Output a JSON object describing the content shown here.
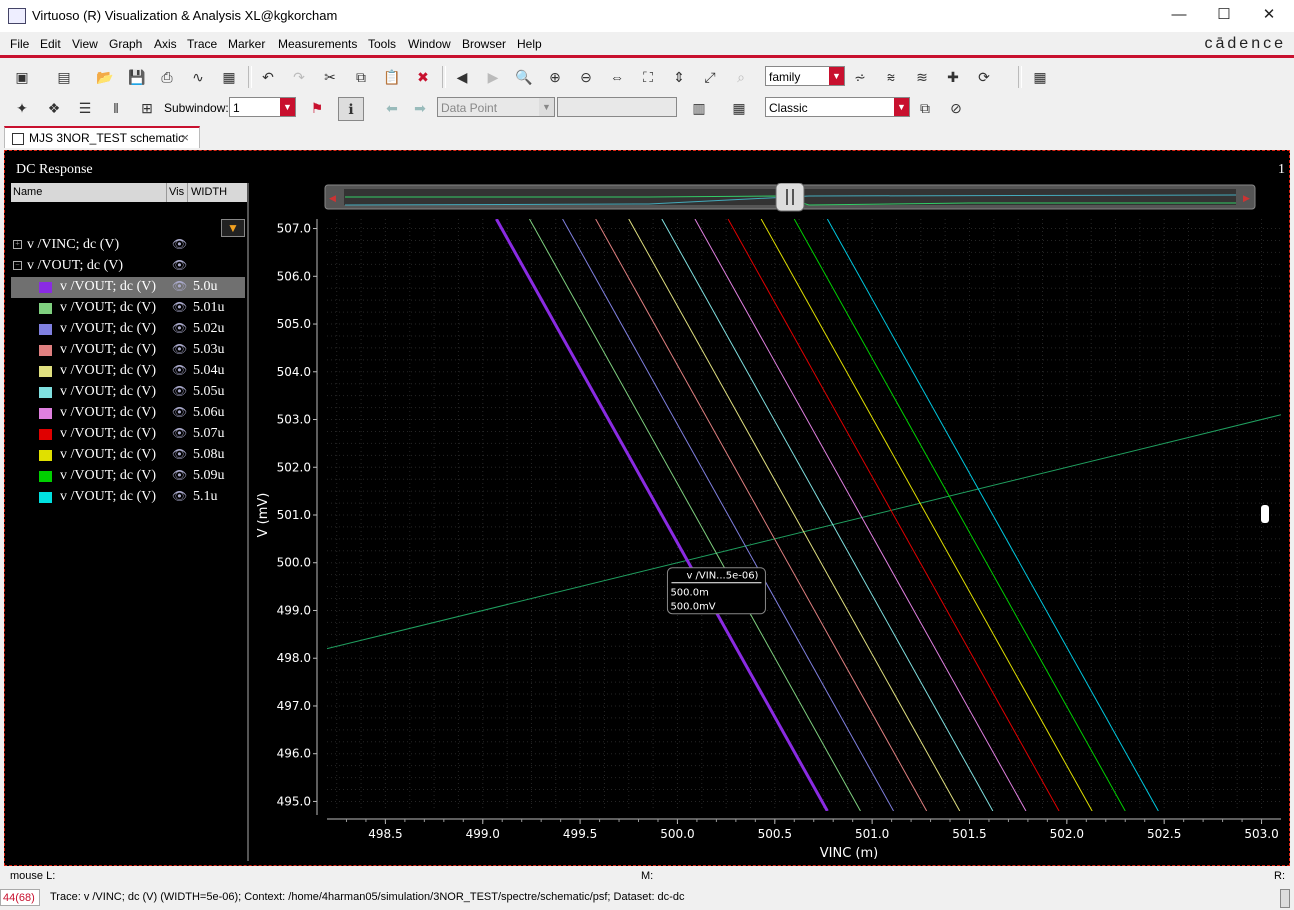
{
  "window": {
    "title": "Virtuoso (R) Visualization & Analysis XL@kgkorcham",
    "minimize": "—",
    "maximize": "☐",
    "close": "✕"
  },
  "menu": [
    "File",
    "Edit",
    "View",
    "Graph",
    "Axis",
    "Trace",
    "Marker",
    "Measurements",
    "Tools",
    "Window",
    "Browser",
    "Help"
  ],
  "brand": "cādence",
  "toolbar1": {
    "family_combo": "family"
  },
  "toolbar2": {
    "subwindow_label": "Subwindow:",
    "subwindow_value": "1",
    "datapoint_combo": "Data Point",
    "style_combo": "Classic"
  },
  "tab": {
    "label": "MJS 3NOR_TEST schematic",
    "close": "×"
  },
  "subwindow": {
    "title": "DC Response",
    "number": "1"
  },
  "legend": {
    "headers": [
      "Name",
      "Vis",
      "WIDTH"
    ],
    "groups": [
      {
        "name": "v /VINC; dc (V)",
        "expander": "+"
      },
      {
        "name": "v /VOUT; dc (V)",
        "expander": "−"
      }
    ],
    "items": [
      {
        "name": "v /VOUT; dc (V)",
        "width": "5.0u",
        "color": "#8a2be2",
        "selected": true
      },
      {
        "name": "v /VOUT; dc (V)",
        "width": "5.01u",
        "color": "#7fd07f"
      },
      {
        "name": "v /VOUT; dc (V)",
        "width": "5.02u",
        "color": "#8080e0"
      },
      {
        "name": "v /VOUT; dc (V)",
        "width": "5.03u",
        "color": "#e08080"
      },
      {
        "name": "v /VOUT; dc (V)",
        "width": "5.04u",
        "color": "#e0e080"
      },
      {
        "name": "v /VOUT; dc (V)",
        "width": "5.05u",
        "color": "#80e0e0"
      },
      {
        "name": "v /VOUT; dc (V)",
        "width": "5.06u",
        "color": "#e080e0"
      },
      {
        "name": "v /VOUT; dc (V)",
        "width": "5.07u",
        "color": "#e00000"
      },
      {
        "name": "v /VOUT; dc (V)",
        "width": "5.08u",
        "color": "#e0e000"
      },
      {
        "name": "v /VOUT; dc (V)",
        "width": "5.09u",
        "color": "#00d000"
      },
      {
        "name": "v /VOUT; dc (V)",
        "width": "5.1u",
        "color": "#00e0e0"
      }
    ]
  },
  "chart_data": {
    "type": "line",
    "xlabel": "VINC (m)",
    "ylabel": "V (mV)",
    "xlim": [
      498.2,
      503.1
    ],
    "ylim": [
      494.8,
      507.2
    ],
    "xticks": [
      "498.5",
      "499.0",
      "499.5",
      "500.0",
      "500.5",
      "501.0",
      "501.5",
      "502.0",
      "502.5",
      "503.0"
    ],
    "yticks": [
      "495.0",
      "496.0",
      "497.0",
      "498.0",
      "499.0",
      "500.0",
      "501.0",
      "502.0",
      "503.0",
      "504.0",
      "505.0",
      "506.0",
      "507.0"
    ],
    "grid": true,
    "series": [
      {
        "name": "v /VINC; dc (V)",
        "color": "#20a060",
        "x": [
          498.2,
          503.1
        ],
        "y": [
          498.2,
          503.1
        ]
      },
      {
        "name": "5.0u",
        "color": "#8a2be2",
        "x": [
          499.07,
          500.77
        ],
        "y": [
          507.2,
          494.8
        ]
      },
      {
        "name": "5.01u",
        "color": "#7fd07f",
        "x": [
          499.24,
          500.94
        ],
        "y": [
          507.2,
          494.8
        ]
      },
      {
        "name": "5.02u",
        "color": "#8080e0",
        "x": [
          499.41,
          501.11
        ],
        "y": [
          507.2,
          494.8
        ]
      },
      {
        "name": "5.03u",
        "color": "#e08080",
        "x": [
          499.58,
          501.28
        ],
        "y": [
          507.2,
          494.8
        ]
      },
      {
        "name": "5.04u",
        "color": "#e0e080",
        "x": [
          499.75,
          501.45
        ],
        "y": [
          507.2,
          494.8
        ]
      },
      {
        "name": "5.05u",
        "color": "#80e0e0",
        "x": [
          499.92,
          501.62
        ],
        "y": [
          507.2,
          494.8
        ]
      },
      {
        "name": "5.06u",
        "color": "#e080e0",
        "x": [
          500.09,
          501.79
        ],
        "y": [
          507.2,
          494.8
        ]
      },
      {
        "name": "5.07u",
        "color": "#e00000",
        "x": [
          500.26,
          501.96
        ],
        "y": [
          507.2,
          494.8
        ]
      },
      {
        "name": "5.08u",
        "color": "#e0e000",
        "x": [
          500.43,
          502.13
        ],
        "y": [
          507.2,
          494.8
        ]
      },
      {
        "name": "5.09u",
        "color": "#00d000",
        "x": [
          500.6,
          502.3
        ],
        "y": [
          507.2,
          494.8
        ]
      },
      {
        "name": "5.1u",
        "color": "#00c8e0",
        "x": [
          500.77,
          502.47
        ],
        "y": [
          507.2,
          494.8
        ]
      }
    ],
    "marker": {
      "x": 500.0,
      "y": 500.0,
      "label": "v /VIN...5e-06)",
      "line1": "500.0m",
      "line2": "500.0mV"
    }
  },
  "status": {
    "mouse_l": "mouse L:",
    "mouse_m": "M:",
    "mouse_r": "R:",
    "counter": "44(68)",
    "message": "Trace: v /VINC; dc (V) (WIDTH=5e-06); Context: /home/4harman05/simulation/3NOR_TEST/spectre/schematic/psf; Dataset: dc-dc"
  }
}
